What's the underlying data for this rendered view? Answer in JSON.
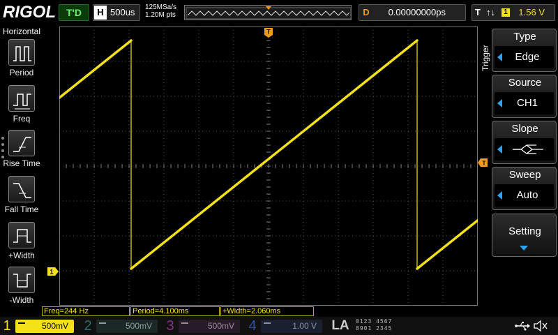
{
  "header": {
    "logo": "RIGOL",
    "run_status": "T'D",
    "horizontal_letter": "H",
    "timebase": "500us",
    "sample_rate": "125MSa/s",
    "mem_depth": "1.20M pts",
    "delay_letter": "D",
    "delay": "0.00000000ps",
    "trigger_letter": "T",
    "trigger_channel": "1",
    "trigger_level": "1.56 V"
  },
  "left_menu": {
    "title": "Horizontal",
    "items": [
      {
        "label": "Period",
        "icon": "period-icon"
      },
      {
        "label": "Freq",
        "icon": "frequency-icon"
      },
      {
        "label": "Rise Time",
        "icon": "rise-time-icon"
      },
      {
        "label": "Fall Time",
        "icon": "fall-time-icon"
      },
      {
        "label": "+Width",
        "icon": "positive-width-icon"
      },
      {
        "label": "-Width",
        "icon": "negative-width-icon"
      }
    ]
  },
  "right_menu": {
    "vertical_label": "Trigger",
    "items": [
      {
        "title": "Type",
        "value": "Edge"
      },
      {
        "title": "Source",
        "value": "CH1"
      },
      {
        "title": "Slope",
        "value": ""
      },
      {
        "title": "Sweep",
        "value": "Auto"
      }
    ],
    "setting_label": "Setting"
  },
  "measurements": [
    {
      "label": "Freq=244 Hz"
    },
    {
      "label": "Period=4.100ms"
    },
    {
      "label": "+Width=2.060ms"
    }
  ],
  "channels": [
    {
      "num": "1",
      "scale": "500mV",
      "color": "#f5e11a",
      "active": true
    },
    {
      "num": "2",
      "scale": "500mV",
      "color": "#1fa59b",
      "active": false
    },
    {
      "num": "3",
      "scale": "500mV",
      "color": "#c83fc8",
      "active": false
    },
    {
      "num": "4",
      "scale": "1.00 V",
      "color": "#3b6fd8",
      "active": false
    }
  ],
  "la": {
    "label": "LA",
    "bits_row1": "0123 4567",
    "bits_row2": "8901 2345"
  },
  "trace": {
    "type": "sawtooth",
    "color": "#f5e11a",
    "period_ms": 4.1,
    "timebase_us_per_div": 500,
    "volts_per_div": 0.5
  },
  "colors": {
    "accent": "#2ea3f2",
    "trigger_marker": "#f59a1e",
    "grid": "#555555",
    "ch1": "#f5e11a"
  }
}
